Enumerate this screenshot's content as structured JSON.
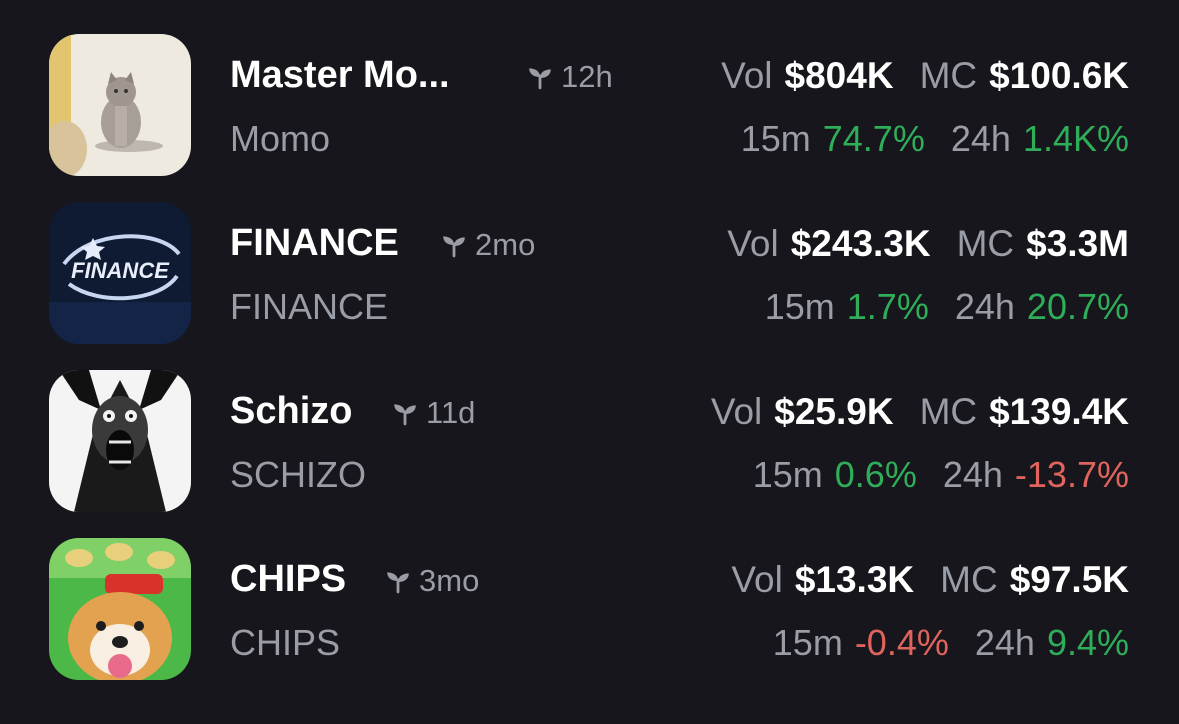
{
  "colors": {
    "background": "#16161c",
    "positive": "#2fae5a",
    "negative": "#e0645e",
    "muted": "#9a9ca6"
  },
  "labels": {
    "vol": "Vol",
    "mc": "MC",
    "m15": "15m",
    "h24": "24h"
  },
  "tokens": [
    {
      "name": "Master Mo...",
      "ticker": "Momo",
      "age": "12h",
      "age_icon": "sprout-icon",
      "avatar": "cat-photo",
      "vol": "$804K",
      "mc": "$100.6K",
      "change_15m": "74.7%",
      "change_15m_dir": "up",
      "change_24h": "1.4K%",
      "change_24h_dir": "up"
    },
    {
      "name": "FINANCE",
      "ticker": "FINANCE",
      "age": "2mo",
      "age_icon": "sprout-icon",
      "avatar": "finance-logo",
      "avatar_text": "FINANCE",
      "vol": "$243.3K",
      "mc": "$3.3M",
      "change_15m": "1.7%",
      "change_15m_dir": "up",
      "change_24h": "20.7%",
      "change_24h_dir": "up"
    },
    {
      "name": "Schizo",
      "ticker": "SCHIZO",
      "age": "11d",
      "age_icon": "sprout-icon",
      "avatar": "screaming-face-drawing",
      "vol": "$25.9K",
      "mc": "$139.4K",
      "change_15m": "0.6%",
      "change_15m_dir": "up",
      "change_24h": "-13.7%",
      "change_24h_dir": "down"
    },
    {
      "name": "CHIPS",
      "ticker": "CHIPS",
      "age": "3mo",
      "age_icon": "sprout-icon",
      "avatar": "dog-with-chips",
      "vol": "$13.3K",
      "mc": "$97.5K",
      "change_15m": "-0.4%",
      "change_15m_dir": "down",
      "change_24h": "9.4%",
      "change_24h_dir": "up"
    }
  ]
}
